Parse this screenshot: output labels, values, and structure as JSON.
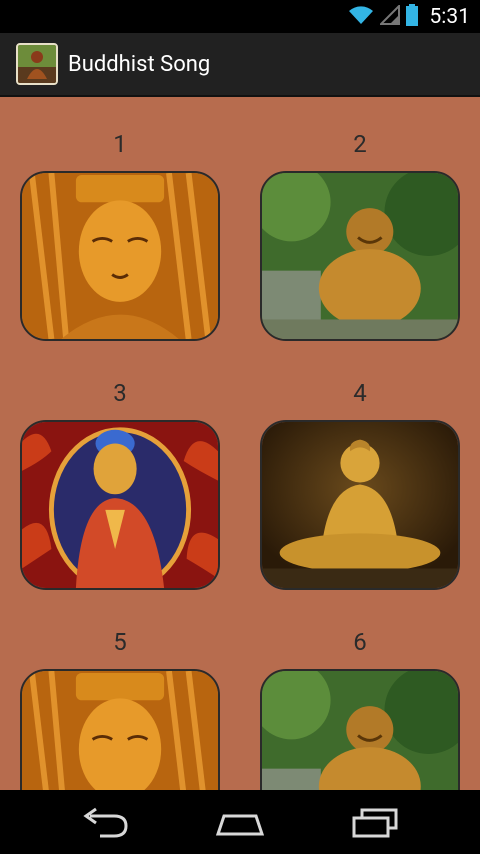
{
  "status_bar": {
    "time": "5:31"
  },
  "action_bar": {
    "title": "Buddhist Song",
    "icon": "buddha-app-icon"
  },
  "grid": {
    "items": [
      {
        "number": "1",
        "image": "golden-buddha-face"
      },
      {
        "number": "2",
        "image": "laughing-buddha-statue"
      },
      {
        "number": "3",
        "image": "buddha-flame-halo"
      },
      {
        "number": "4",
        "image": "seated-buddha"
      },
      {
        "number": "5",
        "image": "golden-buddha-face"
      },
      {
        "number": "6",
        "image": "laughing-buddha-statue"
      }
    ]
  },
  "nav_bar": {
    "icons": [
      "back-icon",
      "home-icon",
      "recents-icon"
    ]
  },
  "colors": {
    "background": "#b76c4e",
    "action_bar": "#212121",
    "status_accent": "#33b5e5"
  }
}
